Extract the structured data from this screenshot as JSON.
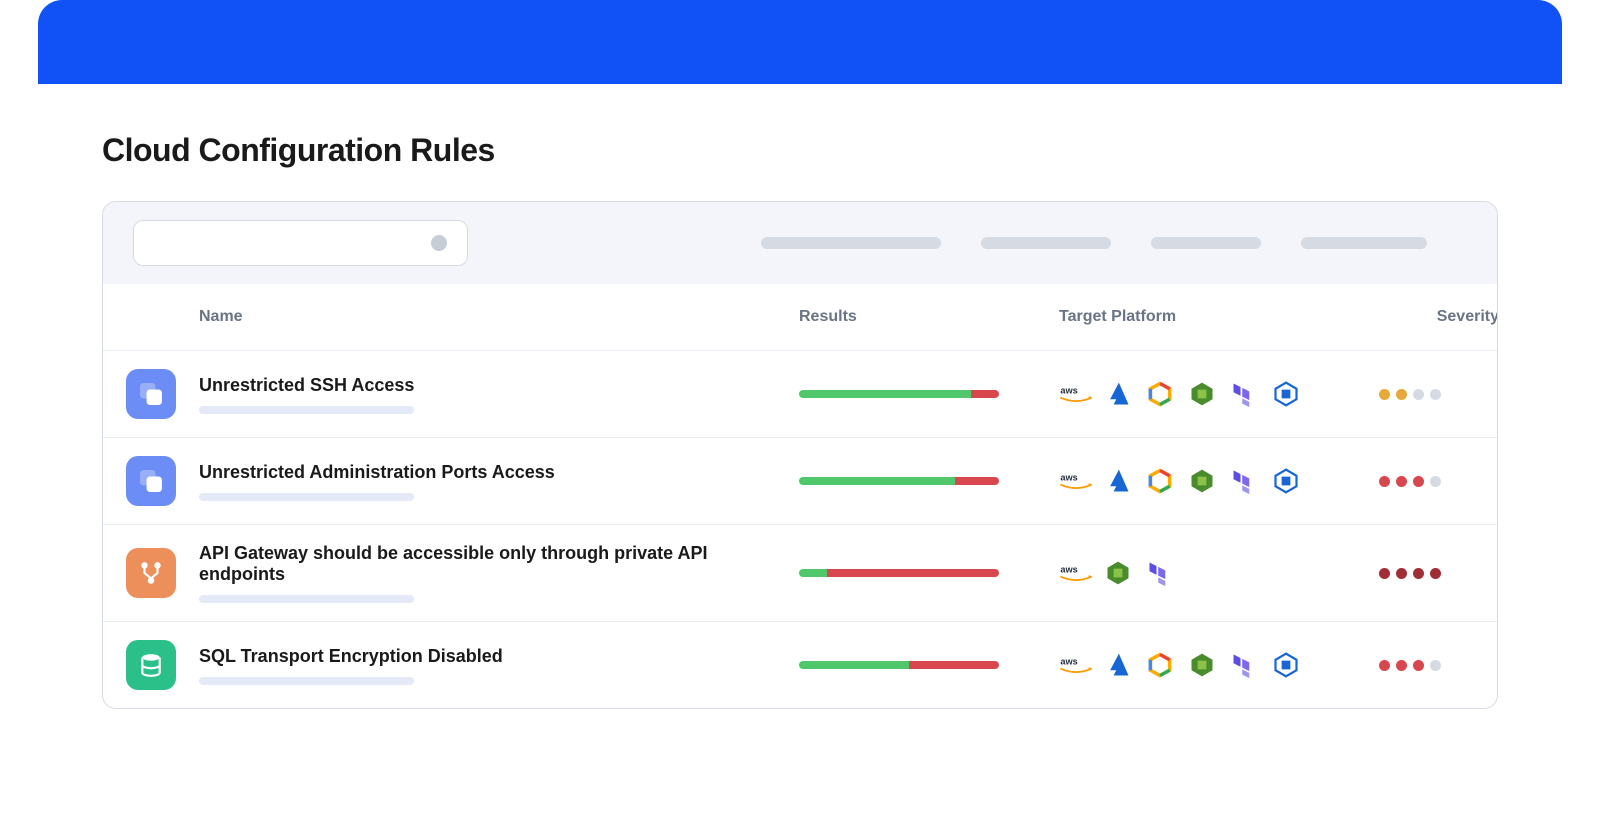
{
  "title": "Cloud Configuration Rules",
  "columns": {
    "name": "Name",
    "results": "Results",
    "target": "Target Platform",
    "severity": "Severity"
  },
  "rows": [
    {
      "icon": "security-group",
      "icon_color": "blue",
      "name": "Unrestricted SSH Access",
      "green_pct": 86,
      "platforms": [
        "aws",
        "azure",
        "gcp",
        "custom-green",
        "terraform",
        "custom-blue"
      ],
      "severity_theme": "amber",
      "severity_filled": 2
    },
    {
      "icon": "security-group",
      "icon_color": "blue",
      "name": "Unrestricted Administration Ports Access",
      "green_pct": 78,
      "platforms": [
        "aws",
        "azure",
        "gcp",
        "custom-green",
        "terraform",
        "custom-blue"
      ],
      "severity_theme": "red",
      "severity_filled": 3
    },
    {
      "icon": "api-gateway",
      "icon_color": "orange",
      "name": "API Gateway should be accessible only through private API endpoints",
      "green_pct": 14,
      "platforms": [
        "aws",
        "custom-green",
        "terraform"
      ],
      "severity_theme": "dkred",
      "severity_filled": 4
    },
    {
      "icon": "database",
      "icon_color": "green",
      "name": "SQL Transport Encryption Disabled",
      "green_pct": 55,
      "platforms": [
        "aws",
        "azure",
        "gcp",
        "custom-green",
        "terraform",
        "custom-blue"
      ],
      "severity_theme": "red",
      "severity_filled": 3
    }
  ]
}
